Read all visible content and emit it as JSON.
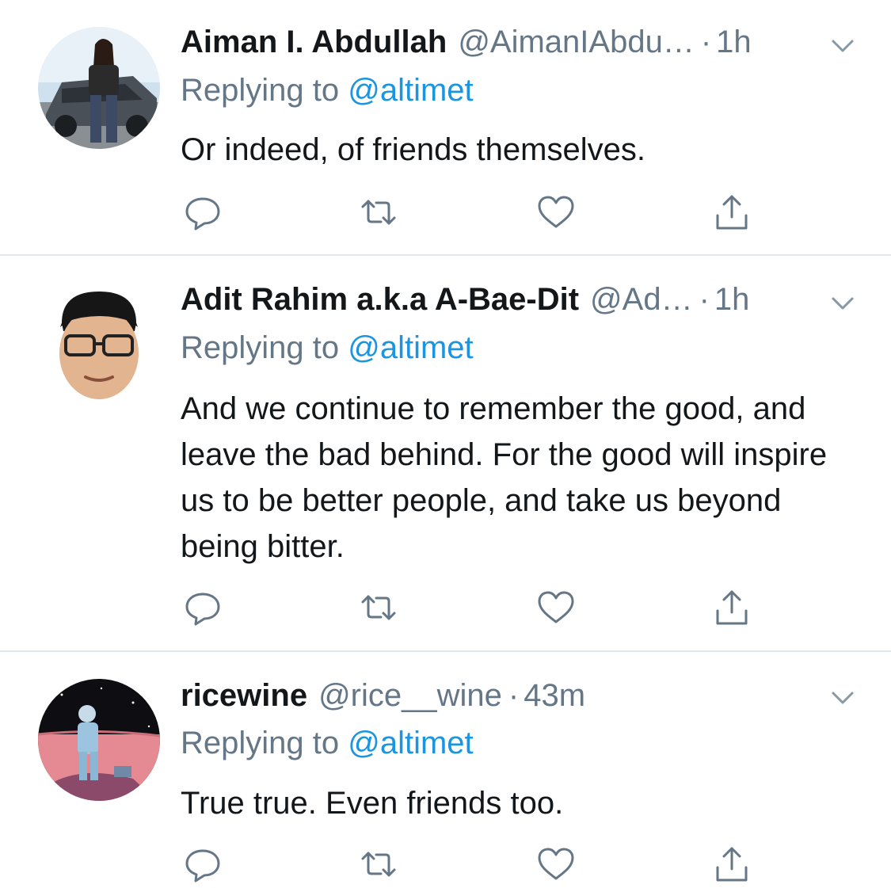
{
  "tweets": [
    {
      "name": "Aiman I. Abdullah",
      "handle": "@AimanIAbdu…",
      "separator": "·",
      "time": "1h",
      "replying_prefix": "Replying to",
      "replying_to": "@altimet",
      "text": "Or indeed, of friends themselves."
    },
    {
      "name": "Adit Rahim a.k.a A-Bae-Dit",
      "handle": "@Ad…",
      "separator": "·",
      "time": "1h",
      "replying_prefix": "Replying to",
      "replying_to": "@altimet",
      "text": "And we continue to remember the good, and leave the bad behind. For the good will inspire us to be better people, and take us beyond being bitter."
    },
    {
      "name": "ricewine",
      "handle": "@rice__wine",
      "separator": "·",
      "time": "43m",
      "replying_prefix": "Replying to",
      "replying_to": "@altimet",
      "text": "True true. Even friends too."
    }
  ],
  "icons": {
    "reply": "reply-icon",
    "retweet": "retweet-icon",
    "like": "heart-icon",
    "share": "share-icon",
    "more": "chevron-down-icon"
  },
  "colors": {
    "text": "#14171a",
    "secondary": "#657786",
    "link": "#1b95e0",
    "divider": "#e1e8ed"
  }
}
